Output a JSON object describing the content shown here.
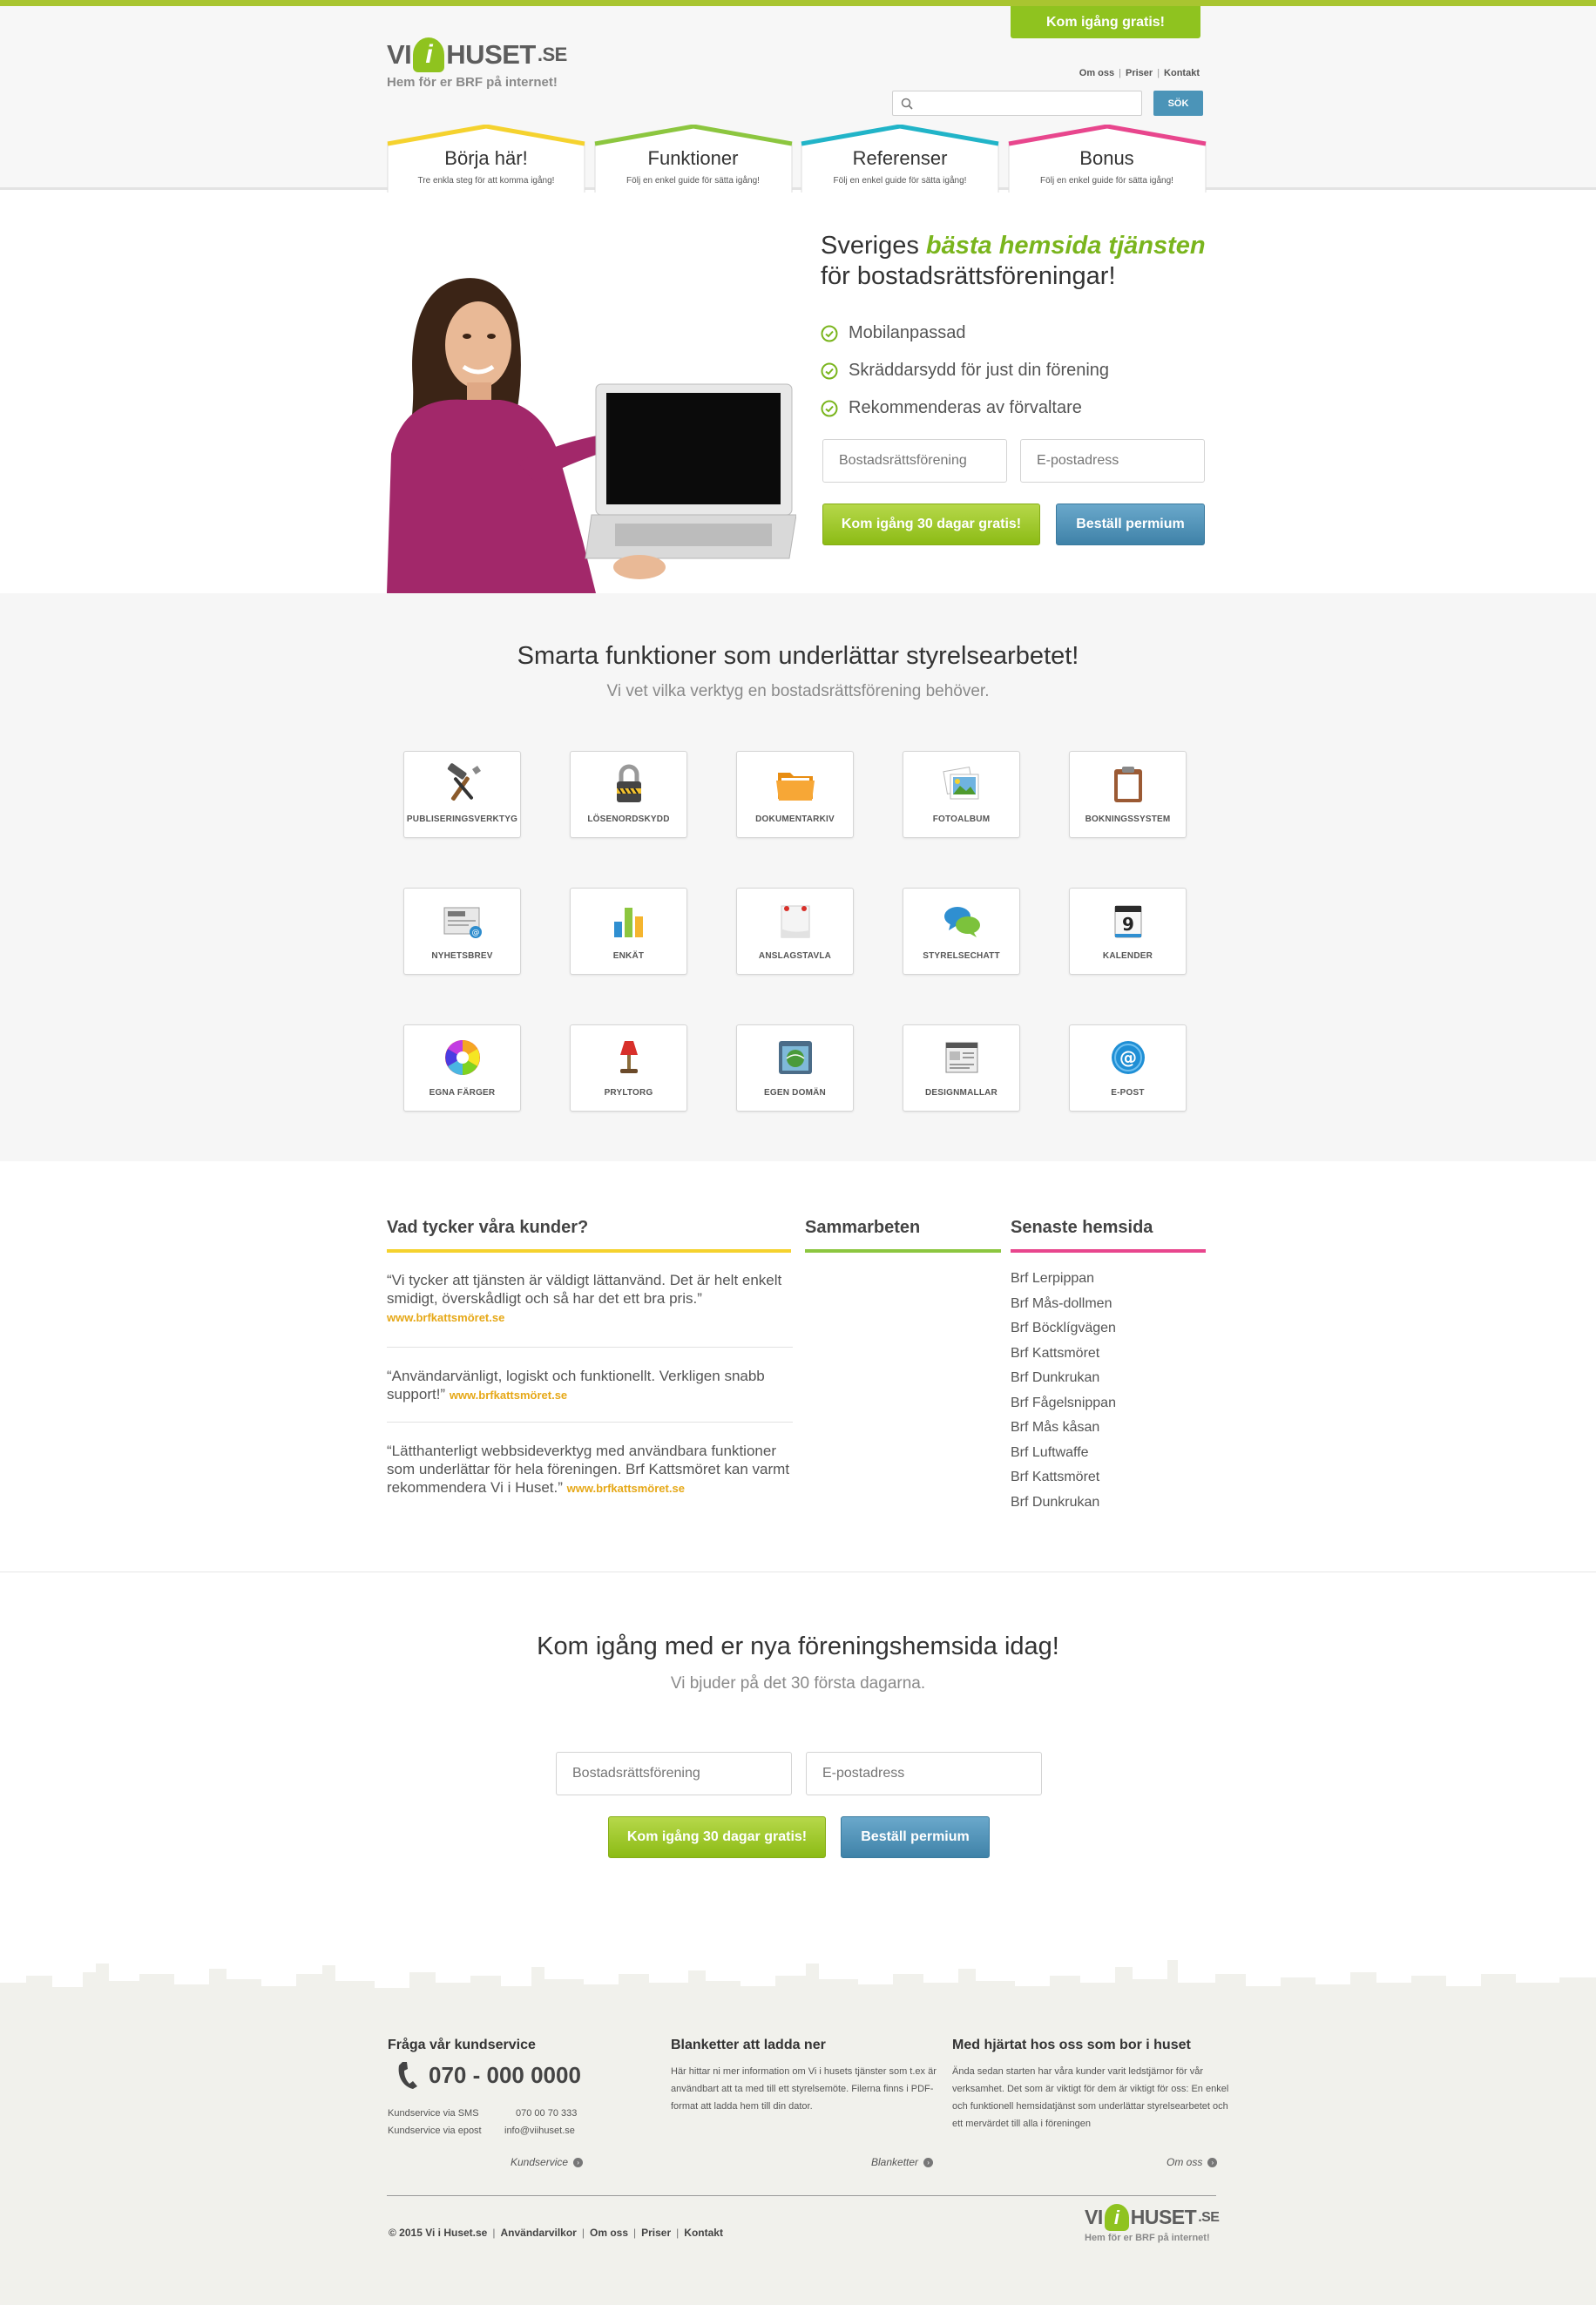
{
  "header": {
    "cta_top": "Kom igång gratis!",
    "logo_tagline": "Hem för er BRF på internet!",
    "links": [
      "Om oss",
      "Priser",
      "Kontakt"
    ],
    "search_button": "SÖK",
    "search_placeholder": ""
  },
  "nav": [
    {
      "title": "Börja här!",
      "sub": "Tre enkla steg för att komma igång!",
      "color": "#f5d22e"
    },
    {
      "title": "Funktioner",
      "sub": "Följ en enkel guide för sätta igång!",
      "color": "#8cc63f"
    },
    {
      "title": "Referenser",
      "sub": "Följ en enkel guide för sätta igång!",
      "color": "#21b4c8"
    },
    {
      "title": "Bonus",
      "sub": "Följ en enkel guide för sätta igång!",
      "color": "#e8468d"
    }
  ],
  "hero": {
    "title_pre": "Sveriges ",
    "title_highlight": "bästa hemsida tjänsten",
    "title_line2": "för bostadsrättsföreningar!",
    "checks": [
      "Mobilanpassad",
      "Skräddarsydd för just din förening",
      "Rekommenderas av förvaltare"
    ],
    "input_brf_placeholder": "Bostadsrättsförening",
    "input_email_placeholder": "E-postadress",
    "btn_trial": "Kom igång 30 dagar gratis!",
    "btn_premium": "Beställ permium"
  },
  "features": {
    "title": "Smarta funktioner som underlättar styrelsearbetet!",
    "subtitle": "Vi vet vilka verktyg en bostadsrättsförening behöver.",
    "items": [
      {
        "label": "PUBLISERINGSVERKTYG",
        "icon": "tools-icon"
      },
      {
        "label": "LÖSENORDSKYDD",
        "icon": "padlock-icon"
      },
      {
        "label": "DOKUMENTARKIV",
        "icon": "folder-icon"
      },
      {
        "label": "FOTOALBUM",
        "icon": "photo-icon"
      },
      {
        "label": "BOKNINGSSYSTEM",
        "icon": "clipboard-icon"
      },
      {
        "label": "NYHETSBREV",
        "icon": "newsletter-icon"
      },
      {
        "label": "ENKÄT",
        "icon": "bar-chart-icon"
      },
      {
        "label": "ANSLAGSTAVLA",
        "icon": "noticeboard-icon"
      },
      {
        "label": "STYRELSECHATT",
        "icon": "chat-icon"
      },
      {
        "label": "KALENDER",
        "icon": "calendar-icon"
      },
      {
        "label": "EGNA FÄRGER",
        "icon": "color-wheel-icon"
      },
      {
        "label": "PRYLTORG",
        "icon": "lamp-icon"
      },
      {
        "label": "EGEN DOMÄN",
        "icon": "domain-icon"
      },
      {
        "label": "DESIGNMALLAR",
        "icon": "templates-icon"
      },
      {
        "label": "E-POST",
        "icon": "email-icon"
      }
    ],
    "calendar_day": "9",
    "news_label": "News"
  },
  "info": {
    "testimonials_title": "Vad tycker våra kunder?",
    "partners_title": "Sammarbeten",
    "latest_title": "Senaste hemsida",
    "quotes": [
      {
        "text": "“Vi tycker att tjänsten är väldigt lättanvänd. Det är helt enkelt smidigt, överskådligt och så har det ett bra pris.”",
        "link": "www.brfkattsmöret.se"
      },
      {
        "text": "“Användarvänligt, logiskt och funktionellt. Verkligen snabb support!”",
        "link": "www.brfkattsmöret.se"
      },
      {
        "text": "“Lätthanterligt webbsideverktyg med användbara funktioner som underlättar för hela föreningen. Brf Kattsmöret kan varmt rekommendera Vi i Huset.”",
        "link": "www.brfkattsmöret.se"
      }
    ],
    "latest": [
      "Brf Lerpippan",
      "Brf Mås-dollmen",
      "Brf Böcklígvägen",
      "Brf Kattsmöret",
      "Brf Dunkrukan",
      "Brf Fågelsnippan",
      "Brf Mås kåsan",
      "Brf Luftwaffe",
      "Brf Kattsmöret",
      "Brf Dunkrukan"
    ]
  },
  "cta2": {
    "title": "Kom igång med er nya föreningshemsida idag!",
    "subtitle": "Vi bjuder på det 30 första dagarna.",
    "input_brf_placeholder": "Bostadsrättsförening",
    "input_email_placeholder": "E-postadress",
    "btn_trial": "Kom igång 30 dagar gratis!",
    "btn_premium": "Beställ permium"
  },
  "footer": {
    "col1_title": "Fråga vår kundservice",
    "phone": "070 - 000 0000",
    "sms_label": "Kundservice via SMS",
    "sms_value": "070 00 70 333",
    "mail_label": "Kundservice via epost",
    "mail_value": "info@viihuset.se",
    "col1_more": "Kundservice",
    "col2_title": "Blanketter att ladda ner",
    "col2_text": "Här hittar ni mer information om Vi i husets tjänster som t.ex är användbart att ta med till ett styrelsemöte. Filerna finns i PDF-format att ladda hem till din dator.",
    "col2_more": "Blanketter",
    "col3_title": "Med hjärtat hos oss som bor i huset",
    "col3_text": "Ända sedan starten har våra kunder varit ledstjärnor för vår verksamhet. Det som är viktigt för dem är viktigt för oss: En enkel och funktionell hemsidatjänst som underlättar styrelsearbetet och ett mervärdet till alla i föreningen",
    "col3_more": "Om oss",
    "copyright": "© 2015 Vi i Huset.se",
    "links": [
      "Användarvilkor",
      "Om oss",
      "Priser",
      "Kontakt"
    ],
    "logo_tagline": "Hem för er BRF på internet!"
  },
  "colors": {
    "brand_green": "#8fc31f",
    "brand_blue": "#4b94b8",
    "yellow": "#f5d22e",
    "green": "#8cc63f",
    "cyan": "#21b4c8",
    "pink": "#e8468d"
  }
}
